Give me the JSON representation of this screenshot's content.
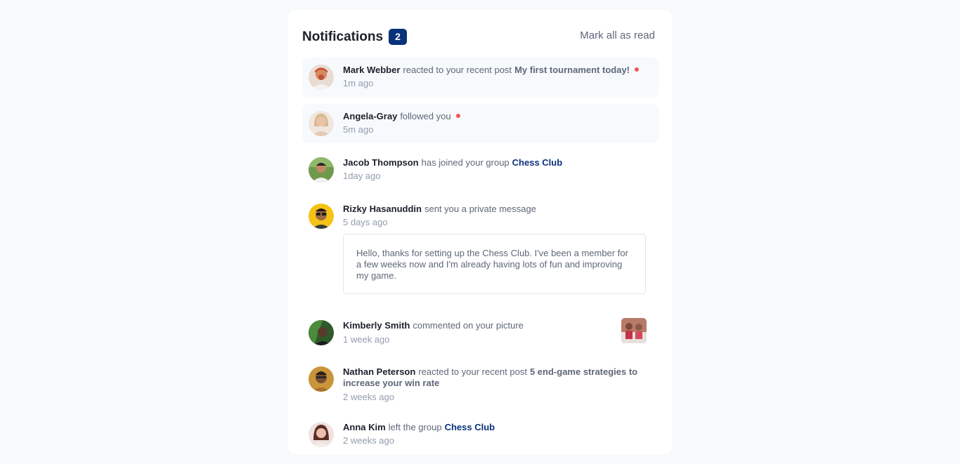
{
  "header": {
    "title": "Notifications",
    "unread_count": "2",
    "mark_all_label": "Mark all as read"
  },
  "notifications": [
    {
      "name": "Mark Webber",
      "action": "reacted to your recent post",
      "target": "My first tournament today!",
      "time": "1m ago",
      "unread": true
    },
    {
      "name": "Angela-Gray",
      "action": "followed you",
      "time": "5m ago",
      "unread": true
    },
    {
      "name": "Jacob Thompson",
      "action": "has joined your group",
      "target": "Chess Club",
      "time": "1day ago",
      "unread": false
    },
    {
      "name": "Rizky Hasanuddin",
      "action": "sent you a private message",
      "time": "5 days ago",
      "message": "Hello, thanks for setting up the Chess Club. I've been a member for a few weeks now and I'm already having lots of fun and improving my game.",
      "unread": false
    },
    {
      "name": "Kimberly Smith",
      "action": "commented on your picture",
      "time": "1 week ago",
      "unread": false
    },
    {
      "name": "Nathan Peterson",
      "action": "reacted to your recent post",
      "target": "5 end-game strategies to increase your win rate",
      "time": "2 weeks ago",
      "unread": false
    },
    {
      "name": "Anna Kim",
      "action": "left the group",
      "target": "Chess Club",
      "time": "2 weeks ago",
      "unread": false
    }
  ],
  "colors": {
    "accent": "#0a327b",
    "unread_dot": "#f65552",
    "unread_bg": "#f7fafd"
  }
}
